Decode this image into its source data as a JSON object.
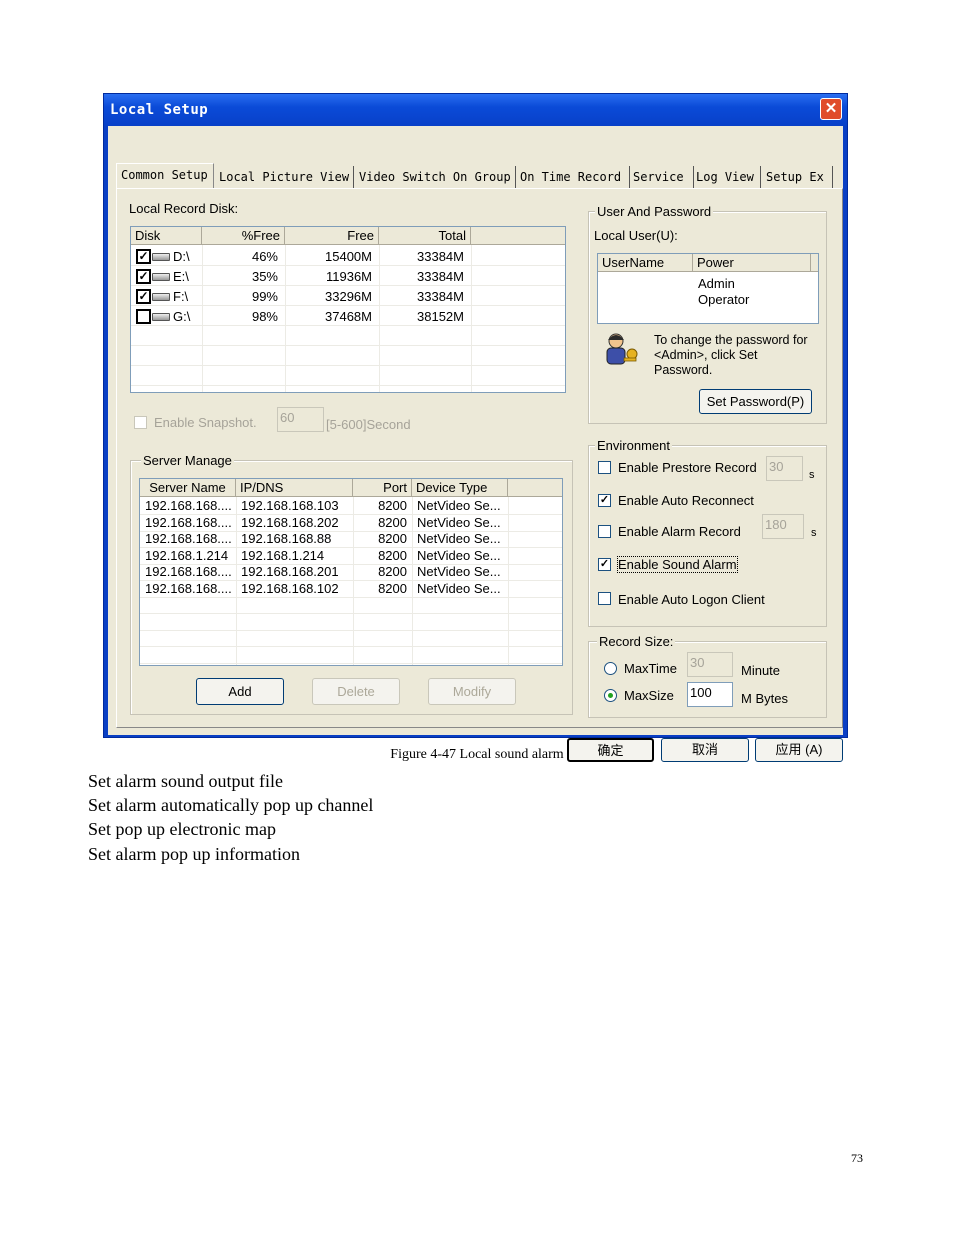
{
  "dialog": {
    "title": "Local Setup",
    "close_glyph": "✕",
    "tabs": [
      "Common Setup",
      "Local Picture View",
      "Video Switch On Group",
      "On Time Record",
      "Service",
      "Log View",
      "Setup Ex"
    ],
    "active_tab": "Common Setup",
    "local_record_disk": {
      "label": "Local Record Disk:",
      "columns": [
        "Disk",
        "%Free",
        "Free",
        "Total"
      ],
      "rows": [
        {
          "checked": true,
          "disk": "D:\\",
          "pct_free": "46%",
          "free": "15400M",
          "total": "33384M"
        },
        {
          "checked": true,
          "disk": "E:\\",
          "pct_free": "35%",
          "free": "11936M",
          "total": "33384M"
        },
        {
          "checked": true,
          "disk": "F:\\",
          "pct_free": "99%",
          "free": "33296M",
          "total": "33384M"
        },
        {
          "checked": false,
          "disk": "G:\\",
          "pct_free": "98%",
          "free": "37468M",
          "total": "38152M"
        }
      ]
    },
    "snapshot": {
      "label": "Enable Snapshot.",
      "value": "60",
      "range": "[5-600]Second",
      "checked": false
    },
    "server_manage": {
      "title": "Server Manage",
      "columns": [
        "Server Name",
        "IP/DNS",
        "Port",
        "Device Type"
      ],
      "rows": [
        {
          "name": "192.168.168....",
          "ip": "192.168.168.103",
          "port": "8200",
          "type": "NetVideo Se..."
        },
        {
          "name": "192.168.168....",
          "ip": "192.168.168.202",
          "port": "8200",
          "type": "NetVideo Se..."
        },
        {
          "name": "192.168.168....",
          "ip": "192.168.168.88",
          "port": "8200",
          "type": "NetVideo Se..."
        },
        {
          "name": "192.168.1.214",
          "ip": "192.168.1.214",
          "port": "8200",
          "type": "NetVideo Se..."
        },
        {
          "name": "192.168.168....",
          "ip": "192.168.168.201",
          "port": "8200",
          "type": "NetVideo Se..."
        },
        {
          "name": "192.168.168....",
          "ip": "192.168.168.102",
          "port": "8200",
          "type": "NetVideo Se..."
        }
      ],
      "buttons": {
        "add": "Add",
        "delete": "Delete",
        "modify": "Modify"
      }
    },
    "user_password": {
      "title": "User And Password",
      "local_user_label": "Local User(U):",
      "columns": [
        "UserName",
        "Power"
      ],
      "rows": [
        {
          "username": "",
          "power": "Admin"
        },
        {
          "username": "",
          "power": "Operator"
        }
      ],
      "hint_line1": "To change the password for",
      "hint_line2": "<Admin>, click Set",
      "hint_line3": "Password.",
      "set_password_button": "Set Password(P)"
    },
    "environment": {
      "title": "Environment",
      "prestore": {
        "label": "Enable Prestore Record",
        "checked": false,
        "value": "30",
        "unit": "s"
      },
      "auto_reconnect": {
        "label": "Enable Auto Reconnect",
        "checked": true
      },
      "alarm_record": {
        "label": "Enable Alarm Record",
        "checked": false,
        "value": "180",
        "unit": "s"
      },
      "sound_alarm": {
        "label": "Enable Sound Alarm",
        "checked": true
      },
      "auto_logon": {
        "label": "Enable Auto Logon Client",
        "checked": false
      }
    },
    "record_size": {
      "title": "Record Size:",
      "max_time": {
        "label": "MaxTime",
        "value": "30",
        "unit": "Minute",
        "selected": false
      },
      "max_size": {
        "label": "MaxSize",
        "value": "100",
        "unit": "M Bytes",
        "selected": true
      }
    },
    "footer_buttons": {
      "ok": "确定",
      "cancel": "取消",
      "apply": "应用 (A)"
    }
  },
  "caption": "Figure 4-47 Local sound alarm",
  "bullets": [
    "Set alarm sound output file",
    "Set alarm automatically pop up channel",
    "Set pop up electronic map",
    "Set alarm pop up information"
  ],
  "page_number": "73"
}
